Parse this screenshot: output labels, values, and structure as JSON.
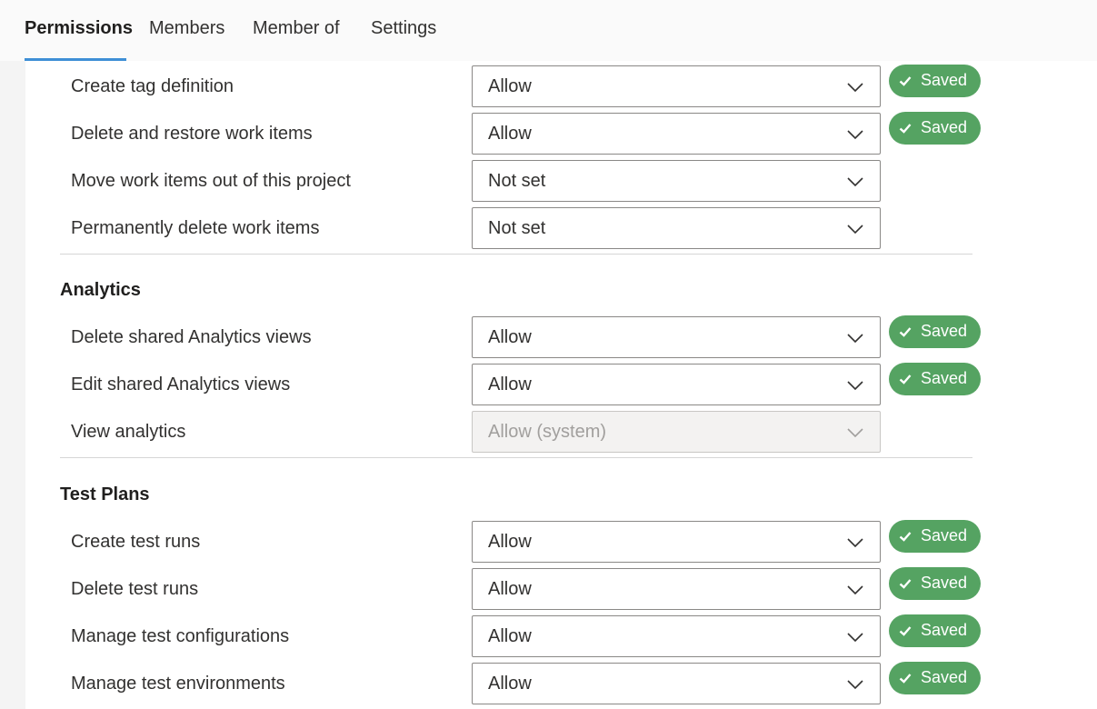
{
  "tabs": [
    {
      "label": "Permissions",
      "active": true
    },
    {
      "label": "Members",
      "active": false
    },
    {
      "label": "Member of",
      "active": false
    },
    {
      "label": "Settings",
      "active": false
    }
  ],
  "saved_label": "Saved",
  "colors": {
    "accent": "#3e8fd6",
    "saved_badge": "#55a362",
    "border": "#8a8886"
  },
  "work_items": {
    "rows": [
      {
        "label": "Create tag definition",
        "value": "Allow",
        "saved": true
      },
      {
        "label": "Delete and restore work items",
        "value": "Allow",
        "saved": true
      },
      {
        "label": "Move work items out of this project",
        "value": "Not set",
        "saved": false
      },
      {
        "label": "Permanently delete work items",
        "value": "Not set",
        "saved": false
      }
    ]
  },
  "analytics": {
    "title": "Analytics",
    "rows": [
      {
        "label": "Delete shared Analytics views",
        "value": "Allow",
        "saved": true
      },
      {
        "label": "Edit shared Analytics views",
        "value": "Allow",
        "saved": true
      },
      {
        "label": "View analytics",
        "value": "Allow (system)",
        "saved": false,
        "disabled": true
      }
    ]
  },
  "test_plans": {
    "title": "Test Plans",
    "rows": [
      {
        "label": "Create test runs",
        "value": "Allow",
        "saved": true
      },
      {
        "label": "Delete test runs",
        "value": "Allow",
        "saved": true
      },
      {
        "label": "Manage test configurations",
        "value": "Allow",
        "saved": true
      },
      {
        "label": "Manage test environments",
        "value": "Allow",
        "saved": true
      }
    ]
  }
}
